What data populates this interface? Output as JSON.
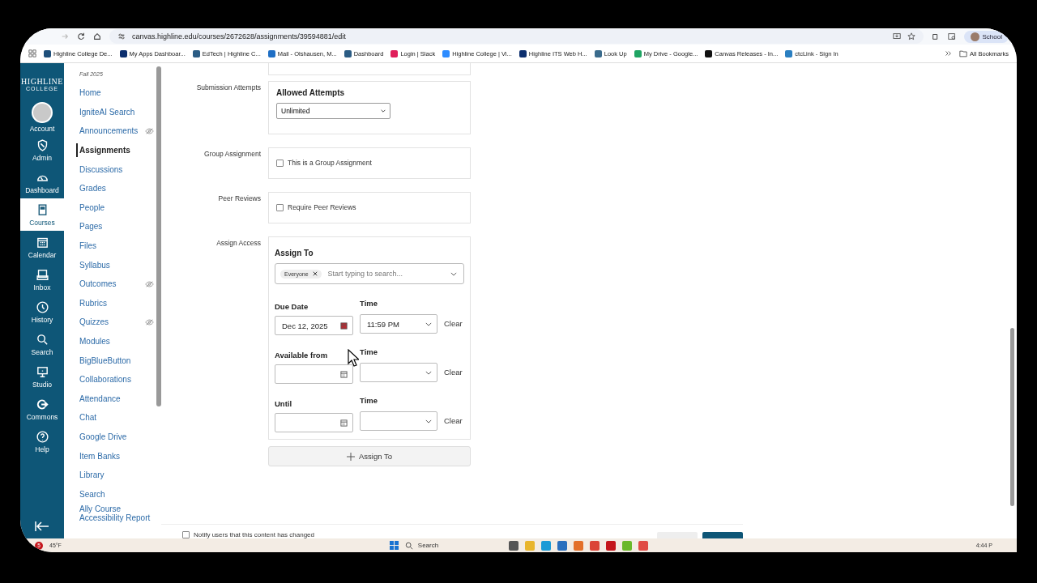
{
  "browser": {
    "url": "canvas.highline.edu/courses/2672628/assignments/39594881/edit",
    "profile": "School",
    "bookmarks": [
      "Highline College De...",
      "My Apps Dashboar...",
      "EdTech | Highline C...",
      "Mail - Olshausen, M...",
      "Dashboard",
      "Login | Slack",
      "Highline College | Vi...",
      "Highline ITS Web H...",
      "Look Up",
      "My Drive - Google...",
      "Canvas Releases - In...",
      "ctcLink - Sign In"
    ],
    "all_bookmarks": "All Bookmarks"
  },
  "logo": {
    "line_1": "HIGHLINE",
    "line_2": "COLLEGE"
  },
  "global_nav": [
    {
      "label": "Account",
      "selected": false
    },
    {
      "label": "Admin",
      "selected": false
    },
    {
      "label": "Dashboard",
      "selected": false
    },
    {
      "label": "Courses",
      "selected": true
    },
    {
      "label": "Calendar",
      "selected": false
    },
    {
      "label": "Inbox",
      "selected": false
    },
    {
      "label": "History",
      "selected": false
    },
    {
      "label": "Search",
      "selected": false
    },
    {
      "label": "Studio",
      "selected": false
    },
    {
      "label": "Commons",
      "selected": false
    },
    {
      "label": "Help",
      "selected": false
    }
  ],
  "course_nav": {
    "term": "Fall 2025",
    "items": [
      {
        "label": "Home",
        "selected": false,
        "hidden": false
      },
      {
        "label": "IgniteAI Search",
        "selected": false,
        "hidden": false
      },
      {
        "label": "Announcements",
        "selected": false,
        "hidden": true
      },
      {
        "label": "Assignments",
        "selected": true,
        "hidden": false
      },
      {
        "label": "Discussions",
        "selected": false,
        "hidden": false
      },
      {
        "label": "Grades",
        "selected": false,
        "hidden": false
      },
      {
        "label": "People",
        "selected": false,
        "hidden": false
      },
      {
        "label": "Pages",
        "selected": false,
        "hidden": false
      },
      {
        "label": "Files",
        "selected": false,
        "hidden": false
      },
      {
        "label": "Syllabus",
        "selected": false,
        "hidden": false
      },
      {
        "label": "Outcomes",
        "selected": false,
        "hidden": true
      },
      {
        "label": "Rubrics",
        "selected": false,
        "hidden": false
      },
      {
        "label": "Quizzes",
        "selected": false,
        "hidden": true
      },
      {
        "label": "Modules",
        "selected": false,
        "hidden": false
      },
      {
        "label": "BigBlueButton",
        "selected": false,
        "hidden": false
      },
      {
        "label": "Collaborations",
        "selected": false,
        "hidden": false
      },
      {
        "label": "Attendance",
        "selected": false,
        "hidden": false
      },
      {
        "label": "Chat",
        "selected": false,
        "hidden": false
      },
      {
        "label": "Google Drive",
        "selected": false,
        "hidden": false
      },
      {
        "label": "Item Banks",
        "selected": false,
        "hidden": false
      },
      {
        "label": "Library",
        "selected": false,
        "hidden": false
      },
      {
        "label": "Search",
        "selected": false,
        "hidden": false
      },
      {
        "label": "Ally Course Accessibility Report",
        "selected": false,
        "hidden": false
      }
    ]
  },
  "form": {
    "submission_attempts": {
      "label": "Submission Attempts",
      "heading": "Allowed Attempts",
      "value": "Unlimited"
    },
    "group_assignment": {
      "label": "Group Assignment",
      "option": "This is a Group Assignment",
      "checked": false
    },
    "peer_reviews": {
      "label": "Peer Reviews",
      "option": "Require Peer Reviews",
      "checked": false
    },
    "assign_access": {
      "label": "Assign Access",
      "heading": "Assign To",
      "tag": "Everyone",
      "placeholder": "Start typing to search...",
      "dates": [
        {
          "label": "Due Date",
          "value": "Dec 12, 2025",
          "time_label": "Time",
          "time": "11:59 PM",
          "clear": "Clear"
        },
        {
          "label": "Available from",
          "time_label": "Time",
          "clear": "Clear"
        },
        {
          "label": "Until",
          "time_label": "Time",
          "clear": "Clear"
        }
      ],
      "add_button": "Assign To"
    },
    "notify": {
      "label": "Notify users that this content has changed",
      "checked": false
    }
  },
  "taskbar": {
    "weather": "45°F",
    "badge": "5",
    "search": "Search",
    "time": "4:44 P"
  }
}
